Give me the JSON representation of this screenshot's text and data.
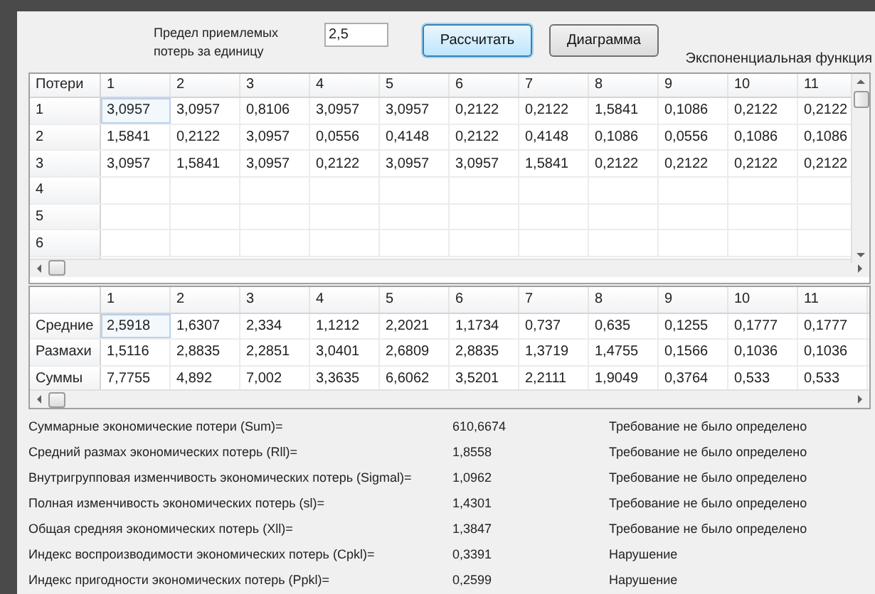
{
  "limit": {
    "label": "Предел приемлемых потерь за единицу",
    "value": "2,5"
  },
  "buttons": [
    {
      "label": "Рассчитать",
      "focused": true
    },
    {
      "label": "Диаграмма",
      "focused": false
    }
  ],
  "function_label": "Экспоненциальная функция",
  "losses_table": {
    "corner": "Потери",
    "columns": [
      "1",
      "2",
      "3",
      "4",
      "5",
      "6",
      "7",
      "8",
      "9",
      "10",
      "11"
    ],
    "rows": [
      {
        "header": "1",
        "first_cell_focused": true,
        "cells": [
          "3,0957",
          "3,0957",
          "0,8106",
          "3,0957",
          "3,0957",
          "0,2122",
          "0,2122",
          "1,5841",
          "0,1086",
          "0,2122",
          "0,2122"
        ]
      },
      {
        "header": "2",
        "first_cell_focused": false,
        "cells": [
          "1,5841",
          "0,2122",
          "3,0957",
          "0,0556",
          "0,4148",
          "0,2122",
          "0,4148",
          "0,1086",
          "0,0556",
          "0,1086",
          "0,1086"
        ]
      },
      {
        "header": "3",
        "first_cell_focused": false,
        "cells": [
          "3,0957",
          "1,5841",
          "3,0957",
          "0,2122",
          "3,0957",
          "3,0957",
          "1,5841",
          "0,2122",
          "0,2122",
          "0,2122",
          "0,2122"
        ]
      },
      {
        "header": "4",
        "first_cell_focused": false,
        "cells": []
      },
      {
        "header": "5",
        "first_cell_focused": false,
        "cells": []
      },
      {
        "header": "6",
        "first_cell_focused": false,
        "cells": []
      }
    ]
  },
  "summary_table": {
    "columns": [
      "1",
      "2",
      "3",
      "4",
      "5",
      "6",
      "7",
      "8",
      "9",
      "10",
      "11"
    ],
    "rows": [
      {
        "header": "Средние",
        "first_cell_focused": true,
        "cells": [
          "2,5918",
          "1,6307",
          "2,334",
          "1,1212",
          "2,2021",
          "1,1734",
          "0,737",
          "0,635",
          "0,1255",
          "0,1777",
          "0,1777"
        ]
      },
      {
        "header": "Размахи",
        "first_cell_focused": false,
        "cells": [
          "1,5116",
          "2,8835",
          "2,2851",
          "3,0401",
          "2,6809",
          "2,8835",
          "1,3719",
          "1,4755",
          "0,1566",
          "0,1036",
          "0,1036"
        ]
      },
      {
        "header": "Суммы",
        "first_cell_focused": false,
        "cells": [
          "7,7755",
          "4,892",
          "7,002",
          "3,3635",
          "6,6062",
          "3,5201",
          "2,2111",
          "1,9049",
          "0,3764",
          "0,533",
          "0,533"
        ]
      }
    ]
  },
  "metrics": [
    {
      "label": "Суммарные экономические потери (Sum)=",
      "value": "610,6674",
      "status": "Требование не было определено"
    },
    {
      "label": "Средний размах экономических потерь (Rll)=",
      "value": "1,8558",
      "status": "Требование не было определено"
    },
    {
      "label": "Внутригрупповая изменчивость экономических потерь (Sigmal)=",
      "value": "1,0962",
      "status": "Требование не было определено"
    },
    {
      "label": "Полная изменчивость экономических потерь (sl)=",
      "value": "1,4301",
      "status": "Требование не было определено"
    },
    {
      "label": "Общая средняя экономических потерь (Xll)=",
      "value": "1,3847",
      "status": "Требование не было определено"
    },
    {
      "label": "Индекс воспроизводимости экономических потерь (Cpkl)=",
      "value": "0,3391",
      "status": "Нарушение"
    },
    {
      "label": "Индекс пригодности экономических потерь (Ppkl)=",
      "value": "0,2599",
      "status": "Нарушение"
    }
  ]
}
